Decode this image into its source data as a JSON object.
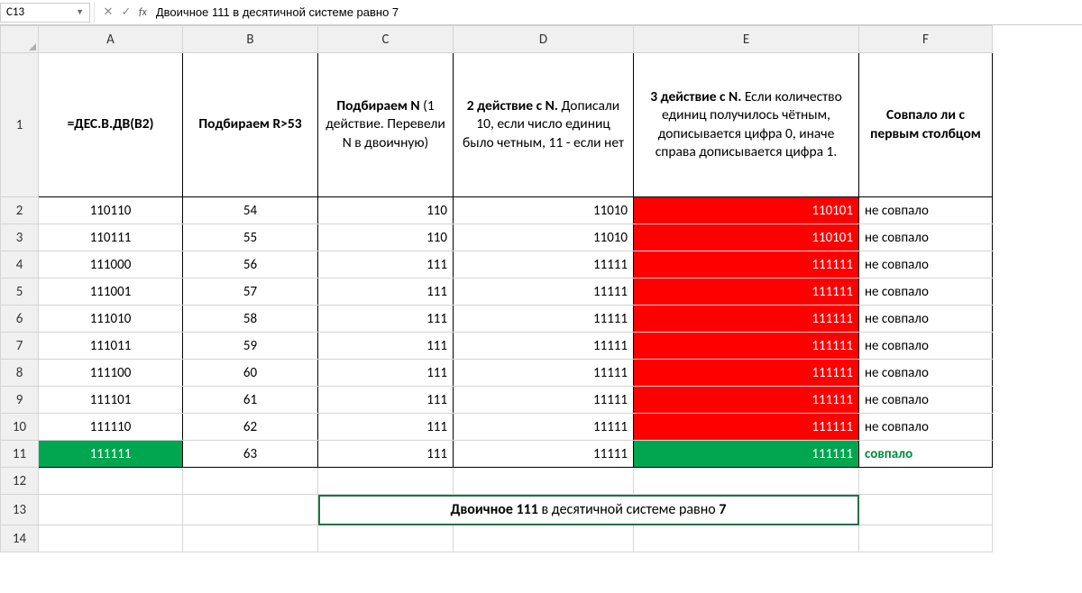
{
  "formula_bar": {
    "cell_ref": "C13",
    "formula": "Двоичное 111 в десятичной системе равно 7"
  },
  "columns": [
    "A",
    "B",
    "C",
    "D",
    "E",
    "F"
  ],
  "headers": {
    "A": "=ДЕС.В.ДВ(B2)",
    "B": "Подбираем R>53",
    "C_bold": "Подбираем N",
    "C_rest": " (1 действие. Перевели N в двоичную)",
    "D_bold": "2 действие с N.",
    "D_rest": " Дописали 10, если число единиц было четным, 11 - если нет",
    "E_bold": "3 действие с N.",
    "E_rest": " Если количество единиц получилось чётным, дописывается цифра 0, иначе справа дописывается цифра 1.",
    "F": "Совпало ли с первым столбцом"
  },
  "rows": [
    {
      "n": 2,
      "A": "110110",
      "B": "54",
      "C": "110",
      "D": "11010",
      "E": "110101",
      "F": "не совпало",
      "e_cls": "red-bg",
      "a_cls": "",
      "f_cls": ""
    },
    {
      "n": 3,
      "A": "110111",
      "B": "55",
      "C": "110",
      "D": "11010",
      "E": "110101",
      "F": "не совпало",
      "e_cls": "red-bg",
      "a_cls": "",
      "f_cls": ""
    },
    {
      "n": 4,
      "A": "111000",
      "B": "56",
      "C": "111",
      "D": "11111",
      "E": "111111",
      "F": "не совпало",
      "e_cls": "red-bg",
      "a_cls": "",
      "f_cls": ""
    },
    {
      "n": 5,
      "A": "111001",
      "B": "57",
      "C": "111",
      "D": "11111",
      "E": "111111",
      "F": "не совпало",
      "e_cls": "red-bg",
      "a_cls": "",
      "f_cls": ""
    },
    {
      "n": 6,
      "A": "111010",
      "B": "58",
      "C": "111",
      "D": "11111",
      "E": "111111",
      "F": "не совпало",
      "e_cls": "red-bg",
      "a_cls": "",
      "f_cls": ""
    },
    {
      "n": 7,
      "A": "111011",
      "B": "59",
      "C": "111",
      "D": "11111",
      "E": "111111",
      "F": "не совпало",
      "e_cls": "red-bg",
      "a_cls": "",
      "f_cls": ""
    },
    {
      "n": 8,
      "A": "111100",
      "B": "60",
      "C": "111",
      "D": "11111",
      "E": "111111",
      "F": "не совпало",
      "e_cls": "red-bg",
      "a_cls": "",
      "f_cls": ""
    },
    {
      "n": 9,
      "A": "111101",
      "B": "61",
      "C": "111",
      "D": "11111",
      "E": "111111",
      "F": "не совпало",
      "e_cls": "red-bg",
      "a_cls": "",
      "f_cls": ""
    },
    {
      "n": 10,
      "A": "111110",
      "B": "62",
      "C": "111",
      "D": "11111",
      "E": "111111",
      "F": "не совпало",
      "e_cls": "red-bg",
      "a_cls": "",
      "f_cls": ""
    },
    {
      "n": 11,
      "A": "111111",
      "B": "63",
      "C": "111",
      "D": "11111",
      "E": "111111",
      "F": "совпало",
      "e_cls": "green-bg",
      "a_cls": "green-bg",
      "f_cls": "green-text"
    }
  ],
  "summary": {
    "part1": "Двоичное 111",
    "part2": " в десятичной системе равно ",
    "part3": "7"
  },
  "row12": 12,
  "row13": 13,
  "row14": 14
}
